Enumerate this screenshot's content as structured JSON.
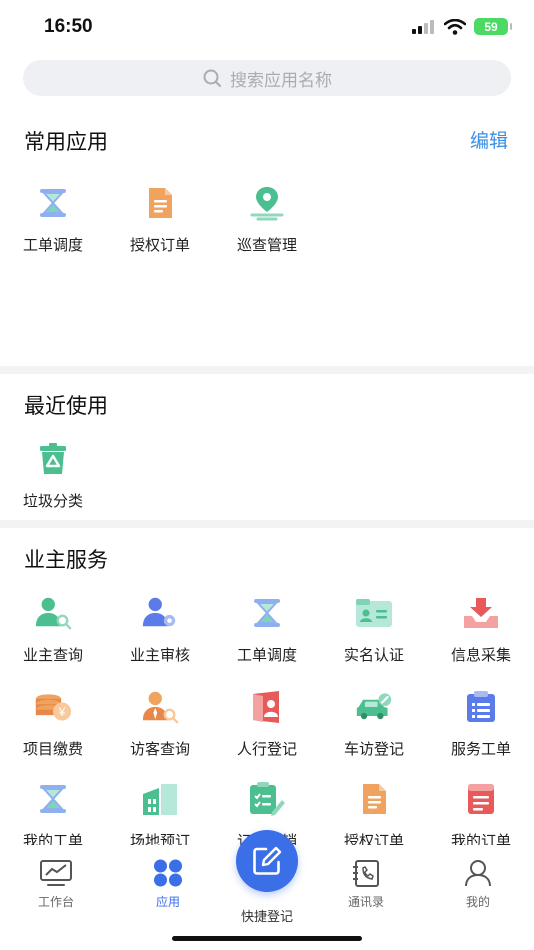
{
  "status": {
    "time": "16:50",
    "battery": "59"
  },
  "search": {
    "placeholder": "搜索应用名称"
  },
  "common_apps": {
    "title": "常用应用",
    "edit_label": "编辑",
    "items": [
      {
        "label": "工单调度",
        "icon": "hourglass-icon"
      },
      {
        "label": "授权订单",
        "icon": "document-icon"
      },
      {
        "label": "巡查管理",
        "icon": "location-pin-icon"
      }
    ]
  },
  "recent": {
    "title": "最近使用",
    "items": [
      {
        "label": "垃圾分类",
        "icon": "trash-bin-icon"
      }
    ]
  },
  "owner_services": {
    "title": "业主服务",
    "items": [
      {
        "label": "业主查询",
        "icon": "user-search-icon"
      },
      {
        "label": "业主审核",
        "icon": "user-gear-icon"
      },
      {
        "label": "工单调度",
        "icon": "hourglass-icon"
      },
      {
        "label": "实名认证",
        "icon": "id-card-icon"
      },
      {
        "label": "信息采集",
        "icon": "download-tray-icon"
      },
      {
        "label": "项目缴费",
        "icon": "coins-icon"
      },
      {
        "label": "访客查询",
        "icon": "visitor-search-icon"
      },
      {
        "label": "人行登记",
        "icon": "door-person-icon"
      },
      {
        "label": "车访登记",
        "icon": "car-icon"
      },
      {
        "label": "服务工单",
        "icon": "clipboard-list-icon"
      },
      {
        "label": "我的工单",
        "icon": "hourglass-icon"
      },
      {
        "label": "场地预订",
        "icon": "building-icon"
      },
      {
        "label": "订单核销",
        "icon": "checklist-pen-icon"
      },
      {
        "label": "授权订单",
        "icon": "document-icon"
      },
      {
        "label": "我的订单",
        "icon": "order-list-icon"
      }
    ]
  },
  "tabbar": {
    "items": [
      {
        "label": "工作台",
        "icon": "monitor-chart-icon"
      },
      {
        "label": "应用",
        "icon": "grid-apps-icon"
      },
      {
        "label": "快捷登记",
        "icon": "edit-icon"
      },
      {
        "label": "通讯录",
        "icon": "contacts-book-icon"
      },
      {
        "label": "我的",
        "icon": "person-icon"
      }
    ],
    "active_color": "#3a6fe8"
  }
}
